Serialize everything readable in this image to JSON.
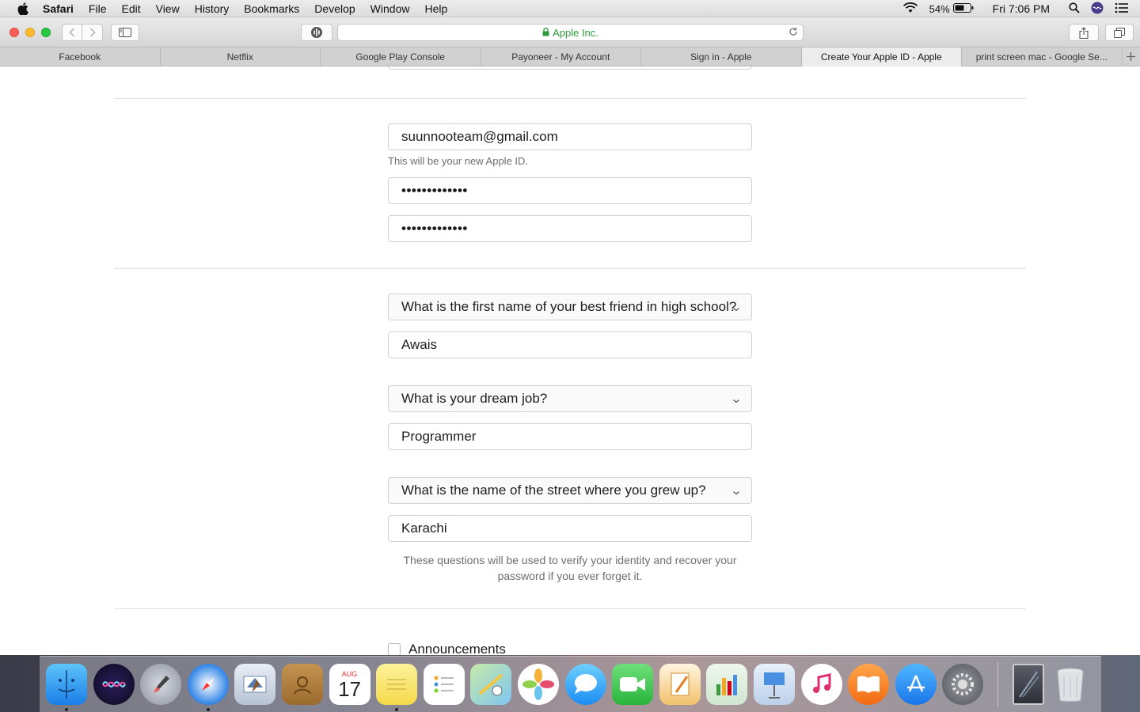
{
  "menubar": {
    "app_name": "Safari",
    "items": [
      "File",
      "Edit",
      "View",
      "History",
      "Bookmarks",
      "Develop",
      "Window",
      "Help"
    ],
    "battery": "54%",
    "clock": "Fri 7:06 PM"
  },
  "browser": {
    "url_display": "Apple Inc.",
    "tabs": [
      {
        "label": "Facebook"
      },
      {
        "label": "Netflix"
      },
      {
        "label": "Google Play Console"
      },
      {
        "label": "Payoneer - My Account"
      },
      {
        "label": "Sign in - Apple"
      },
      {
        "label": "Create Your Apple ID - Apple"
      },
      {
        "label": "print screen mac - Google Se..."
      }
    ],
    "active_tab_index": 5
  },
  "form": {
    "email_value": "suunnooteam@gmail.com",
    "email_hint": "This will be your new Apple ID.",
    "password_mask": "•••••••••••••",
    "confirm_password_mask": "•••••••••••••",
    "questions": [
      {
        "question": "What is the first name of your best friend in high school?",
        "answer": "Awais"
      },
      {
        "question": "What is your dream job?",
        "answer": "Programmer"
      },
      {
        "question": "What is the name of the street where you grew up?",
        "answer": "Karachi"
      }
    ],
    "security_note": "These questions will be used to verify your identity and recover your password if you ever forget it.",
    "announcements_label": "Announcements"
  },
  "dock": {
    "calendar_month": "AUG",
    "calendar_day": "17",
    "apps": [
      "Finder",
      "Siri",
      "Launchpad",
      "Safari",
      "Mail",
      "Contacts",
      "Calendar",
      "Notes",
      "Reminders",
      "Maps",
      "Photos",
      "Messages",
      "FaceTime",
      "Pages",
      "Numbers",
      "Keynote",
      "iTunes",
      "iBooks",
      "App Store",
      "System Preferences",
      "Downloads",
      "Trash"
    ]
  }
}
